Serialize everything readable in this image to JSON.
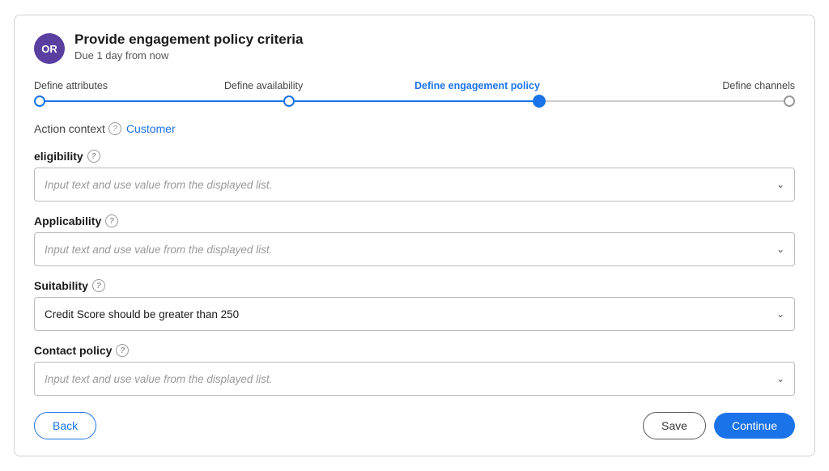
{
  "header": {
    "avatar_initials": "OR",
    "title": "Provide engagement policy criteria",
    "subtitle": "Due 1 day from now"
  },
  "stepper": {
    "steps": [
      {
        "label": "Define attributes",
        "state": "completed"
      },
      {
        "label": "Define availability",
        "state": "completed"
      },
      {
        "label": "Define engagement policy",
        "state": "active"
      },
      {
        "label": "Define channels",
        "state": "pending"
      }
    ]
  },
  "action_context": {
    "label": "Action context",
    "help_icon": "?",
    "value": "Customer"
  },
  "form": {
    "fields": [
      {
        "id": "eligibility",
        "label": "eligibility",
        "help_icon": "?",
        "placeholder": "Input text and use value from the displayed list.",
        "value": ""
      },
      {
        "id": "applicability",
        "label": "Applicability",
        "help_icon": "?",
        "placeholder": "Input text and use value from the displayed list.",
        "value": ""
      },
      {
        "id": "suitability",
        "label": "Suitability",
        "help_icon": "?",
        "placeholder": "",
        "value": "Credit Score should be greater than 250"
      },
      {
        "id": "contact_policy",
        "label": "Contact policy",
        "help_icon": "?",
        "placeholder": "Input text and use value from the displayed list.",
        "value": ""
      }
    ]
  },
  "footer": {
    "back_label": "Back",
    "save_label": "Save",
    "continue_label": "Continue"
  }
}
